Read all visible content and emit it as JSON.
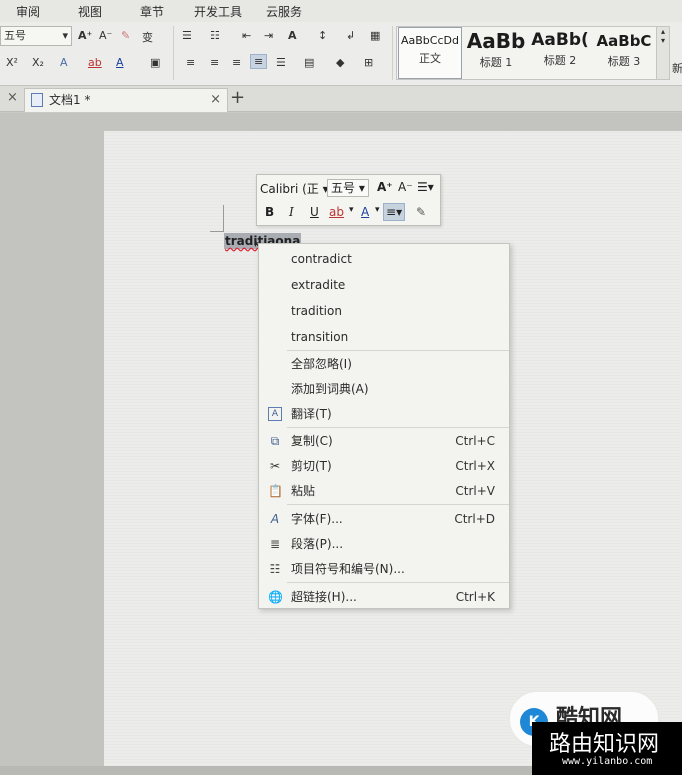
{
  "menubar": {
    "items": [
      "审阅",
      "视图",
      "章节",
      "开发工具",
      "云服务"
    ]
  },
  "ribbon": {
    "font_size": "五号",
    "row1": [
      "A⁺",
      "A⁻",
      "✎",
      "变",
      "☰",
      "☷",
      "⇤",
      "⇥",
      "A",
      "↕",
      "↲",
      "▦"
    ],
    "row2": [
      "X²",
      "X₂",
      "A",
      "ab",
      "A",
      "▣",
      "≡",
      "≡",
      "≡",
      "≡",
      "☰",
      "▤",
      "◆",
      "⊞"
    ],
    "styles": [
      {
        "sample": "AaBbCcDd",
        "name": "正文"
      },
      {
        "sample": "AaBb",
        "name": "标题 1"
      },
      {
        "sample": "AaBb(",
        "name": "标题 2"
      },
      {
        "sample": "AaBbC",
        "name": "标题 3"
      }
    ],
    "more_label": "新"
  },
  "tabs": {
    "document_title": "文档1 *",
    "close_glyph": "×",
    "new_tab_glyph": "+"
  },
  "document": {
    "selected_word": "traditiaona"
  },
  "mini_toolbar": {
    "font_name": "Calibri (正",
    "font_size": "五号",
    "grow": "A⁺",
    "shrink": "A⁻",
    "bold": "B",
    "italic": "I",
    "underline": "U",
    "highlight": "ab",
    "font_color": "A",
    "align": "≡",
    "brush": "✎"
  },
  "context_menu": {
    "suggestions": [
      "contradict",
      "extradite",
      "tradition",
      "transition"
    ],
    "ignore_all": "全部忽略(I)",
    "add_to_dictionary": "添加到词典(A)",
    "translate": "翻译(T)",
    "copy": {
      "label": "复制(C)",
      "shortcut": "Ctrl+C"
    },
    "cut": {
      "label": "剪切(T)",
      "shortcut": "Ctrl+X"
    },
    "paste": {
      "label": "粘贴",
      "shortcut": "Ctrl+V"
    },
    "font": {
      "label": "字体(F)...",
      "shortcut": "Ctrl+D"
    },
    "paragraph": {
      "label": "段落(P)..."
    },
    "bullets": {
      "label": "项目符号和编号(N)..."
    },
    "hyperlink": {
      "label": "超链接(H)...",
      "shortcut": "Ctrl+K"
    }
  },
  "watermark": {
    "logo_letter": "K",
    "top_text": "酷知网",
    "site_name": "路由知识网",
    "url": "www.yilanbo.com"
  },
  "colors": {
    "selection": "#a9adb3",
    "active_button": "#c8d3e1",
    "menu_bg": "#f3f3f0"
  }
}
